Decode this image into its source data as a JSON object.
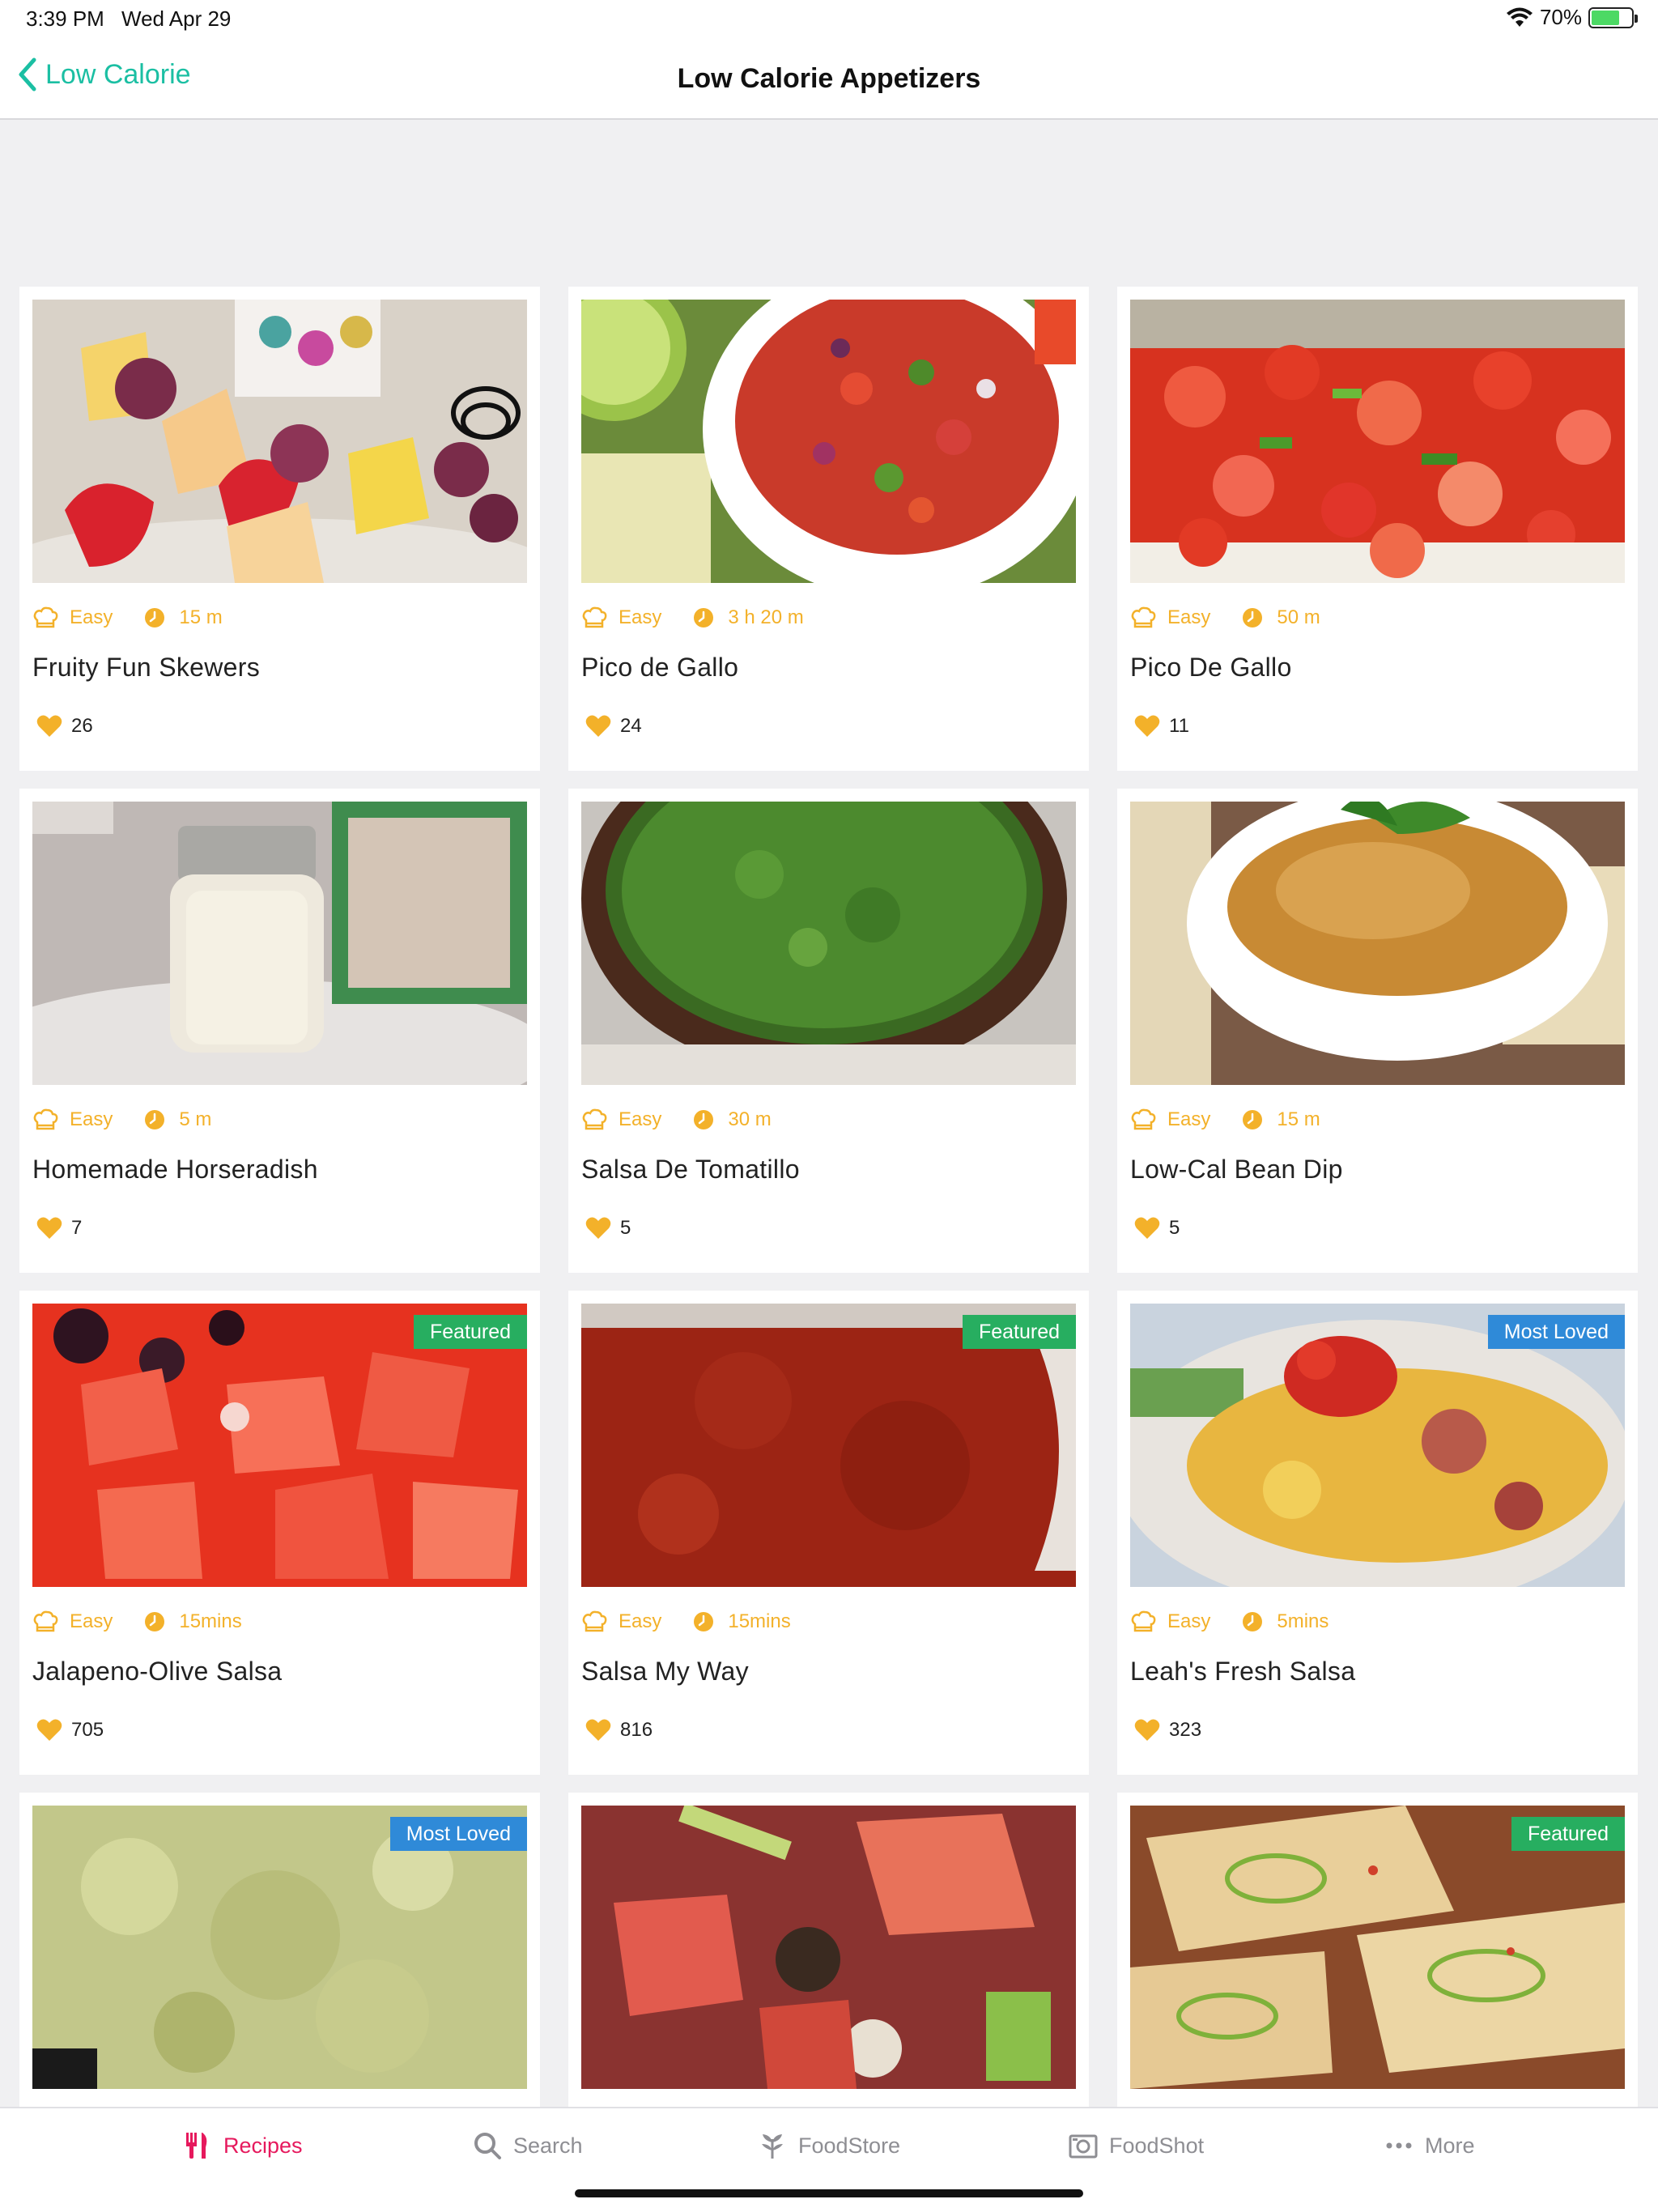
{
  "status_bar": {
    "time": "3:39 PM",
    "date": "Wed Apr 29",
    "battery": "70%",
    "battery_level": 0.7
  },
  "nav": {
    "back_label": "Low Calorie",
    "title": "Low Calorie Appetizers"
  },
  "recipes": [
    {
      "title": "Fruity Fun Skewers",
      "difficulty": "Easy",
      "time": "15 m",
      "likes": "26",
      "badge": ""
    },
    {
      "title": "Pico de Gallo",
      "difficulty": "Easy",
      "time": "3 h 20 m",
      "likes": "24",
      "badge": ""
    },
    {
      "title": "Pico De Gallo",
      "difficulty": "Easy",
      "time": "50 m",
      "likes": "11",
      "badge": ""
    },
    {
      "title": "Homemade Horseradish",
      "difficulty": "Easy",
      "time": "5 m",
      "likes": "7",
      "badge": ""
    },
    {
      "title": "Salsa De Tomatillo",
      "difficulty": "Easy",
      "time": "30 m",
      "likes": "5",
      "badge": ""
    },
    {
      "title": "Low-Cal Bean Dip",
      "difficulty": "Easy",
      "time": "15 m",
      "likes": "5",
      "badge": ""
    },
    {
      "title": "Jalapeno-Olive Salsa",
      "difficulty": "Easy",
      "time": "15mins",
      "likes": "705",
      "badge": "Featured"
    },
    {
      "title": "Salsa My Way",
      "difficulty": "Easy",
      "time": "15mins",
      "likes": "816",
      "badge": "Featured"
    },
    {
      "title": "Leah's Fresh Salsa",
      "difficulty": "Easy",
      "time": "5mins",
      "likes": "323",
      "badge": "Most Loved"
    },
    {
      "title": "",
      "difficulty": "",
      "time": "",
      "likes": "",
      "badge": "Most Loved"
    },
    {
      "title": "",
      "difficulty": "",
      "time": "",
      "likes": "",
      "badge": ""
    },
    {
      "title": "",
      "difficulty": "",
      "time": "",
      "likes": "",
      "badge": "Featured"
    }
  ],
  "tabs": [
    {
      "label": "Recipes",
      "icon": "utensils-icon",
      "active": true
    },
    {
      "label": "Search",
      "icon": "search-icon",
      "active": false
    },
    {
      "label": "FoodStore",
      "icon": "sprout-icon",
      "active": false
    },
    {
      "label": "FoodShot",
      "icon": "camera-icon",
      "active": false
    },
    {
      "label": "More",
      "icon": "more-dots-icon",
      "active": false
    }
  ],
  "colors": {
    "accent": "#1bbfa3",
    "tab_active": "#e6195d",
    "meta": "#f3b12a",
    "featured": "#27ae60",
    "most_loved": "#2f8ad8"
  }
}
